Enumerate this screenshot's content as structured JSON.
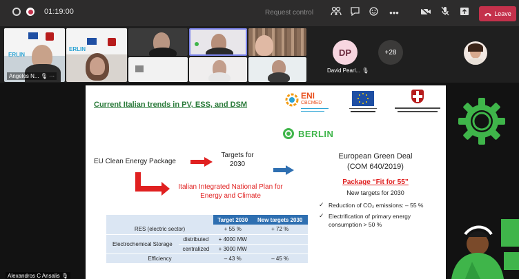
{
  "toolbar": {
    "timer": "01:19:00",
    "request_control": "Request control",
    "leave_label": "Leave",
    "icons": [
      "people-icon",
      "chat-icon",
      "reactions-icon",
      "more-icon",
      "camera-off-icon",
      "mic-off-icon",
      "share-icon"
    ]
  },
  "participants": {
    "tile1_name": "Angelos N...",
    "tile1_more": "···",
    "dp_initials": "DP",
    "dp_name": "David Pearl...",
    "overflow": "+28",
    "presenter": "Alexandros C Ansalis"
  },
  "slide": {
    "title": "Current Italian trends in PV, ESS, and DSM",
    "eni_label": "ENI",
    "eni_sub": "CBCMED",
    "berlin": "BERLIN",
    "eu_package": "EU Clean Energy Package",
    "targets_2030": "Targets for 2030",
    "italian_plan": "Italian Integrated National Plan for Energy and Climate",
    "green_deal": "European Green Deal",
    "green_deal_ref": "(COM 640/2019)",
    "package": "Package “Fit for 55”",
    "new_targets": "New targets for 2030",
    "bullet1": "Reduction of CO₂ emissions: – 55 %",
    "bullet2_line1": "Electrification of primary energy",
    "bullet2_line2": "consumption > 50 %",
    "table": {
      "headers": [
        "",
        "",
        "Target 2030",
        "New targets 2030"
      ],
      "rows": [
        [
          "RES (electric sector)",
          "",
          "+ 55 %",
          "+ 72 %"
        ],
        [
          "Electrochemical Storage",
          "distributed",
          "+ 4000 MW",
          ""
        ],
        [
          "",
          "centralized",
          "+ 3000 MW",
          ""
        ],
        [
          "Efficiency",
          "",
          "– 43 %",
          "– 45 %"
        ]
      ]
    }
  },
  "colors": {
    "toolbar_bg": "#2d2c2c",
    "leave": "#c4314b",
    "title_green": "#2a7a3a",
    "berlin_green": "#3fb54a",
    "red": "#e02020",
    "blue_arrow": "#2e6fb1",
    "gear_green": "#3fb54a"
  }
}
